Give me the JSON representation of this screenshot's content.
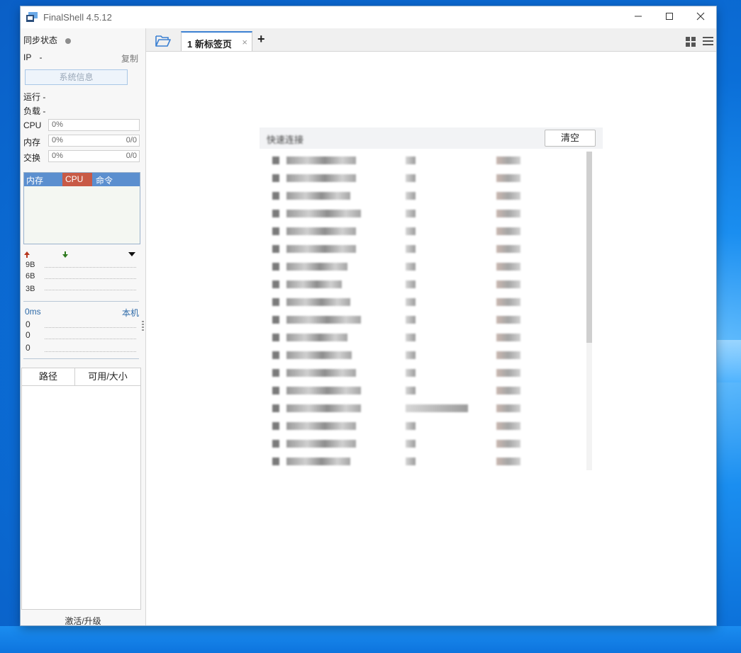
{
  "window": {
    "title": "FinalShell 4.5.12"
  },
  "left_panel": {
    "sync_label": "同步状态",
    "ip_label": "IP",
    "ip_value": "-",
    "copy_label": "复制",
    "sysinfo_button": "系统信息",
    "uptime_label": "运行 -",
    "load_label": "负载 -",
    "meters": [
      {
        "label": "CPU",
        "left": "0%",
        "right": ""
      },
      {
        "label": "内存",
        "left": "0%",
        "right": "0/0"
      },
      {
        "label": "交换",
        "left": "0%",
        "right": "0/0"
      }
    ],
    "process_table": {
      "headers": [
        "内存",
        "CPU",
        "命令"
      ]
    },
    "network": {
      "y_labels": [
        "9B",
        "6B",
        "3B"
      ]
    },
    "ping": {
      "label": "0ms",
      "host": "本机",
      "y_labels": [
        "0",
        "0",
        "0"
      ]
    },
    "filesystem": {
      "headers": [
        "路径",
        "可用/大小"
      ]
    },
    "activate_label": "激活/升级"
  },
  "tabs": [
    {
      "label": "1 新标签页"
    }
  ],
  "quick_connect": {
    "title": "快速连接",
    "clear_button": "清空"
  },
  "colors": {
    "accent": "#3b80d2",
    "proc_header": "#5b8fcf",
    "cpu_header": "#c85a46"
  }
}
